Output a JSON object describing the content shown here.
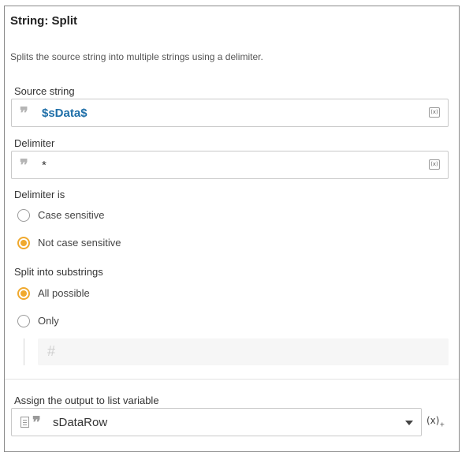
{
  "panel": {
    "title": "String: Split",
    "description": "Splits the source string into multiple strings using a delimiter."
  },
  "source": {
    "label": "Source string",
    "value": "$sData$",
    "var_icon_text": "(x)"
  },
  "delimiter": {
    "label": "Delimiter",
    "value": "*",
    "var_icon_text": "(x)"
  },
  "delimiter_is": {
    "label": "Delimiter is",
    "options": [
      {
        "label": "Case sensitive",
        "checked": false
      },
      {
        "label": "Not case sensitive",
        "checked": true
      }
    ]
  },
  "split": {
    "label": "Split into substrings",
    "options": [
      {
        "label": "All possible",
        "checked": true
      },
      {
        "label": "Only",
        "checked": false
      }
    ],
    "count_placeholder": "#"
  },
  "output": {
    "label": "Assign the output to list variable",
    "value": "sDataRow",
    "add_var_text": "(x)",
    "add_var_sub": "+"
  },
  "colors": {
    "accent": "#f0a92e",
    "variable": "#1f6fa8"
  },
  "icons": {
    "quote": "quote-icon",
    "variable": "variable-icon",
    "hash": "hash-icon",
    "list": "list-icon",
    "dropdown": "chevron-down-icon"
  }
}
